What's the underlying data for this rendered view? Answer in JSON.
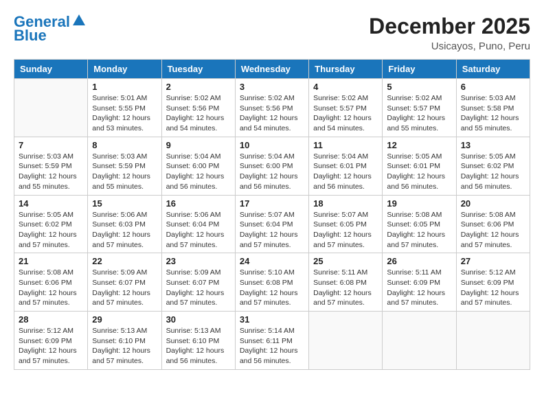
{
  "header": {
    "logo_line1": "General",
    "logo_line2": "Blue",
    "month": "December 2025",
    "location": "Usicayos, Puno, Peru"
  },
  "weekdays": [
    "Sunday",
    "Monday",
    "Tuesday",
    "Wednesday",
    "Thursday",
    "Friday",
    "Saturday"
  ],
  "weeks": [
    [
      {
        "day": null
      },
      {
        "day": "1",
        "sunrise": "5:01 AM",
        "sunset": "5:55 PM",
        "daylight": "12 hours and 53 minutes."
      },
      {
        "day": "2",
        "sunrise": "5:02 AM",
        "sunset": "5:56 PM",
        "daylight": "12 hours and 54 minutes."
      },
      {
        "day": "3",
        "sunrise": "5:02 AM",
        "sunset": "5:56 PM",
        "daylight": "12 hours and 54 minutes."
      },
      {
        "day": "4",
        "sunrise": "5:02 AM",
        "sunset": "5:57 PM",
        "daylight": "12 hours and 54 minutes."
      },
      {
        "day": "5",
        "sunrise": "5:02 AM",
        "sunset": "5:57 PM",
        "daylight": "12 hours and 55 minutes."
      },
      {
        "day": "6",
        "sunrise": "5:03 AM",
        "sunset": "5:58 PM",
        "daylight": "12 hours and 55 minutes."
      }
    ],
    [
      {
        "day": "7",
        "sunrise": "5:03 AM",
        "sunset": "5:59 PM",
        "daylight": "12 hours and 55 minutes."
      },
      {
        "day": "8",
        "sunrise": "5:03 AM",
        "sunset": "5:59 PM",
        "daylight": "12 hours and 55 minutes."
      },
      {
        "day": "9",
        "sunrise": "5:04 AM",
        "sunset": "6:00 PM",
        "daylight": "12 hours and 56 minutes."
      },
      {
        "day": "10",
        "sunrise": "5:04 AM",
        "sunset": "6:00 PM",
        "daylight": "12 hours and 56 minutes."
      },
      {
        "day": "11",
        "sunrise": "5:04 AM",
        "sunset": "6:01 PM",
        "daylight": "12 hours and 56 minutes."
      },
      {
        "day": "12",
        "sunrise": "5:05 AM",
        "sunset": "6:01 PM",
        "daylight": "12 hours and 56 minutes."
      },
      {
        "day": "13",
        "sunrise": "5:05 AM",
        "sunset": "6:02 PM",
        "daylight": "12 hours and 56 minutes."
      }
    ],
    [
      {
        "day": "14",
        "sunrise": "5:05 AM",
        "sunset": "6:02 PM",
        "daylight": "12 hours and 57 minutes."
      },
      {
        "day": "15",
        "sunrise": "5:06 AM",
        "sunset": "6:03 PM",
        "daylight": "12 hours and 57 minutes."
      },
      {
        "day": "16",
        "sunrise": "5:06 AM",
        "sunset": "6:04 PM",
        "daylight": "12 hours and 57 minutes."
      },
      {
        "day": "17",
        "sunrise": "5:07 AM",
        "sunset": "6:04 PM",
        "daylight": "12 hours and 57 minutes."
      },
      {
        "day": "18",
        "sunrise": "5:07 AM",
        "sunset": "6:05 PM",
        "daylight": "12 hours and 57 minutes."
      },
      {
        "day": "19",
        "sunrise": "5:08 AM",
        "sunset": "6:05 PM",
        "daylight": "12 hours and 57 minutes."
      },
      {
        "day": "20",
        "sunrise": "5:08 AM",
        "sunset": "6:06 PM",
        "daylight": "12 hours and 57 minutes."
      }
    ],
    [
      {
        "day": "21",
        "sunrise": "5:08 AM",
        "sunset": "6:06 PM",
        "daylight": "12 hours and 57 minutes."
      },
      {
        "day": "22",
        "sunrise": "5:09 AM",
        "sunset": "6:07 PM",
        "daylight": "12 hours and 57 minutes."
      },
      {
        "day": "23",
        "sunrise": "5:09 AM",
        "sunset": "6:07 PM",
        "daylight": "12 hours and 57 minutes."
      },
      {
        "day": "24",
        "sunrise": "5:10 AM",
        "sunset": "6:08 PM",
        "daylight": "12 hours and 57 minutes."
      },
      {
        "day": "25",
        "sunrise": "5:11 AM",
        "sunset": "6:08 PM",
        "daylight": "12 hours and 57 minutes."
      },
      {
        "day": "26",
        "sunrise": "5:11 AM",
        "sunset": "6:09 PM",
        "daylight": "12 hours and 57 minutes."
      },
      {
        "day": "27",
        "sunrise": "5:12 AM",
        "sunset": "6:09 PM",
        "daylight": "12 hours and 57 minutes."
      }
    ],
    [
      {
        "day": "28",
        "sunrise": "5:12 AM",
        "sunset": "6:09 PM",
        "daylight": "12 hours and 57 minutes."
      },
      {
        "day": "29",
        "sunrise": "5:13 AM",
        "sunset": "6:10 PM",
        "daylight": "12 hours and 57 minutes."
      },
      {
        "day": "30",
        "sunrise": "5:13 AM",
        "sunset": "6:10 PM",
        "daylight": "12 hours and 56 minutes."
      },
      {
        "day": "31",
        "sunrise": "5:14 AM",
        "sunset": "6:11 PM",
        "daylight": "12 hours and 56 minutes."
      },
      {
        "day": null
      },
      {
        "day": null
      },
      {
        "day": null
      }
    ]
  ],
  "labels": {
    "sunrise_prefix": "Sunrise: ",
    "sunset_prefix": "Sunset: ",
    "daylight_prefix": "Daylight: "
  }
}
